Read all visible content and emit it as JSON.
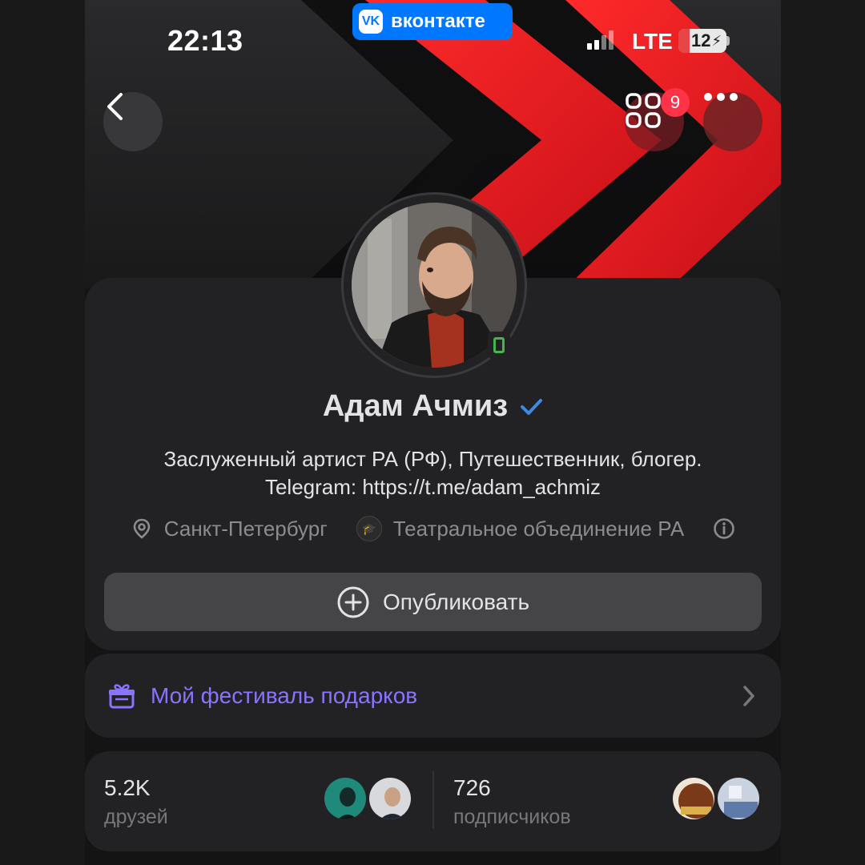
{
  "status_bar": {
    "time": "22:13",
    "network": "LTE",
    "battery": "12",
    "brand_pill": "вконтакте",
    "brand_logo": "VK"
  },
  "header": {
    "apps_badge": "9",
    "back_icon": "chevron-left-icon",
    "apps_icon": "services-grid-icon",
    "more_icon": "more-horizontal-icon"
  },
  "profile": {
    "name": "Адам Ачмиз",
    "bio_line1": "Заслуженный артист РА (РФ), Путешественник, блогер.",
    "bio_line2": "Telegram: https://t.me/adam_achmiz",
    "city": "Санкт-Петербург",
    "org": "Театральное объединение РА",
    "publish_label": "Опубликовать"
  },
  "festival": {
    "label": "Мой фестиваль подарков"
  },
  "stats": {
    "friends_count": "5.2K",
    "friends_label": "друзей",
    "followers_count": "726",
    "followers_label": "подписчиков"
  },
  "colors": {
    "accent_blue": "#0077ff",
    "festival_purple": "#8c73ff",
    "badge_red": "#ff3347",
    "online_green": "#4bb34b",
    "cover_red": "#e5141e"
  }
}
